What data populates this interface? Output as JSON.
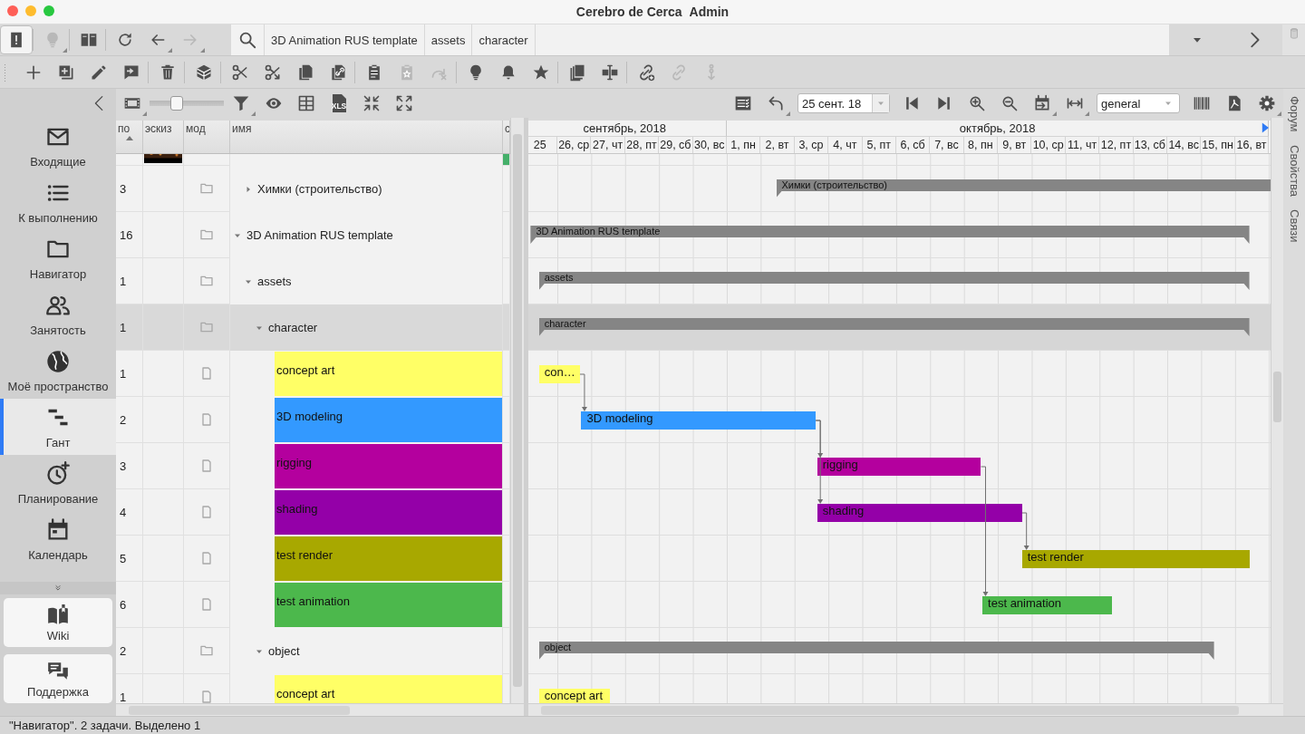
{
  "window": {
    "title": "Cerebro de Cerca",
    "user": "Admin"
  },
  "main_toolbar": {
    "buttons": [
      {
        "kind": "alert",
        "pressed": true,
        "disabled": false,
        "separator": false,
        "menu": false
      },
      {
        "kind": "lightbulb",
        "pressed": false,
        "disabled": true,
        "separator": true,
        "menu": true
      },
      {
        "kind": "book",
        "pressed": false,
        "disabled": false,
        "separator": true,
        "menu": false
      },
      {
        "kind": "refresh",
        "pressed": false,
        "disabled": false,
        "separator": true,
        "menu": false
      },
      {
        "kind": "back",
        "pressed": false,
        "disabled": false,
        "separator": false,
        "menu": true
      },
      {
        "kind": "forward",
        "pressed": false,
        "disabled": true,
        "separator": false,
        "menu": true
      }
    ],
    "breadcrumbs": [
      {
        "label": "3D Animation RUS template"
      },
      {
        "label": "assets"
      },
      {
        "label": "character"
      }
    ]
  },
  "edit_toolbar": {
    "buttons": [
      {
        "kind": "plus",
        "disabled": false,
        "separator": false
      },
      {
        "kind": "addbox",
        "disabled": false,
        "separator": false
      },
      {
        "kind": "pencil",
        "disabled": false,
        "separator": false
      },
      {
        "kind": "reply",
        "disabled": false,
        "separator": false
      },
      {
        "kind": "trash",
        "disabled": false,
        "separator": true
      },
      {
        "kind": "cube",
        "disabled": false,
        "separator": true
      },
      {
        "kind": "scissors",
        "disabled": false,
        "separator": true
      },
      {
        "kind": "scissorsarrow",
        "disabled": false,
        "separator": false
      },
      {
        "kind": "copy",
        "disabled": false,
        "separator": false
      },
      {
        "kind": "copylink",
        "disabled": false,
        "separator": false
      },
      {
        "kind": "clipboard",
        "disabled": false,
        "separator": true
      },
      {
        "kind": "clipstar",
        "disabled": true,
        "separator": false
      },
      {
        "kind": "redo",
        "disabled": true,
        "separator": false
      },
      {
        "kind": "lightbulb",
        "disabled": false,
        "separator": true
      },
      {
        "kind": "bell",
        "disabled": false,
        "separator": false
      },
      {
        "kind": "star",
        "disabled": false,
        "separator": false
      },
      {
        "kind": "stack",
        "disabled": false,
        "separator": true
      },
      {
        "kind": "textcursor",
        "disabled": false,
        "separator": false
      },
      {
        "kind": "linkplus",
        "disabled": false,
        "separator": true
      },
      {
        "kind": "link",
        "disabled": true,
        "separator": false
      },
      {
        "kind": "chaindown",
        "disabled": true,
        "separator": false
      }
    ]
  },
  "view_toolbar": {
    "items": [
      {
        "kind": "film",
        "menu": true
      },
      {
        "kind": "slider",
        "level": 0.35
      },
      {
        "kind": "filter",
        "menu": true
      },
      {
        "kind": "eye",
        "menu": false
      },
      {
        "kind": "grid",
        "menu": false
      },
      {
        "kind": "file",
        "label": "XLS",
        "menu": false
      },
      {
        "kind": "shrink",
        "menu": false
      },
      {
        "kind": "expand",
        "menu": false
      }
    ]
  },
  "gantt_toolbar": {
    "items": [
      {
        "kind": "checklist",
        "menu": false
      },
      {
        "kind": "undo",
        "menu": true
      },
      {
        "kind": "datefield",
        "value": "25 сент. 18"
      },
      {
        "kind": "skipstart",
        "menu": false
      },
      {
        "kind": "skipend",
        "menu": false
      },
      {
        "kind": "zoomin",
        "menu": false
      },
      {
        "kind": "zoomout",
        "menu": false
      },
      {
        "kind": "calendararrow",
        "menu": true
      },
      {
        "kind": "width",
        "menu": true
      },
      {
        "kind": "select",
        "value": "general"
      },
      {
        "kind": "barcode",
        "menu": false
      },
      {
        "kind": "pdf",
        "menu": false
      },
      {
        "kind": "gear",
        "menu": true
      }
    ]
  },
  "sidebar": {
    "items": [
      {
        "kind": "mail",
        "label": "Входящие",
        "selected": false
      },
      {
        "kind": "list",
        "label": "К выполнению",
        "selected": false
      },
      {
        "kind": "folder",
        "label": "Навигатор",
        "selected": false
      },
      {
        "kind": "people",
        "label": "Занятость",
        "selected": false
      },
      {
        "kind": "globe",
        "label": "Моё пространство",
        "selected": false
      },
      {
        "kind": "gantt",
        "label": "Гант",
        "selected": true
      },
      {
        "kind": "clockplus",
        "label": "Планирование",
        "selected": false
      },
      {
        "kind": "calendar",
        "label": "Календарь",
        "selected": false
      }
    ],
    "links": [
      {
        "kind": "bookopen",
        "label": "Wiki"
      },
      {
        "kind": "chat",
        "label": "Поддержка"
      }
    ]
  },
  "table": {
    "columns": [
      {
        "label": "по",
        "sorted": true
      },
      {
        "label": "эскиз",
        "sorted": false
      },
      {
        "label": "мод",
        "sorted": false
      },
      {
        "label": "имя",
        "sorted": false
      },
      {
        "label": "с",
        "sorted": false
      }
    ],
    "rows": [
      {
        "kind": "partial",
        "thumbnail": {
          "kind": "picture"
        },
        "color": "#45b06a",
        "selected": false,
        "children": [
          {
            "kind": "folder",
            "count": "3",
            "name": "Химки (строительство)",
            "expanded": false,
            "selected": false,
            "bar_label": "Химки (строительство)"
          }
        ]
      },
      {
        "kind": "folder",
        "count": "16",
        "name": "3D Animation RUS template",
        "expanded": true,
        "selected": false,
        "bar_label": "3D Animation RUS template",
        "children": [
          {
            "kind": "folder",
            "count": "1",
            "name": "assets",
            "expanded": true,
            "selected": false,
            "bar_label": "assets",
            "children": [
              {
                "kind": "folder",
                "count": "1",
                "name": "character",
                "expanded": true,
                "selected": true,
                "bar_label": "character",
                "children": [
                  {
                    "kind": "task",
                    "count": "1",
                    "name": "concept art",
                    "color": "#ffff66",
                    "selected": false,
                    "bar_label": "con…"
                  },
                  {
                    "kind": "task",
                    "count": "2",
                    "name": "3D modeling",
                    "color": "#3399ff",
                    "selected": false,
                    "bar_label": "3D modeling"
                  },
                  {
                    "kind": "task",
                    "count": "3",
                    "name": "rigging",
                    "color": "#b4009e",
                    "selected": false,
                    "bar_label": "rigging"
                  },
                  {
                    "kind": "task",
                    "count": "4",
                    "name": "shading",
                    "color": "#9400a8",
                    "selected": false,
                    "bar_label": "shading"
                  },
                  {
                    "kind": "task",
                    "count": "5",
                    "name": "test render",
                    "color": "#a8a800",
                    "selected": false,
                    "bar_label": "test render"
                  },
                  {
                    "kind": "task",
                    "count": "6",
                    "name": "test animation",
                    "color": "#4cb84c",
                    "selected": false,
                    "bar_label": "test animation"
                  }
                ]
              },
              {
                "kind": "folder",
                "count": "2",
                "name": "object",
                "expanded": true,
                "selected": false,
                "bar_label": "object",
                "children": [
                  {
                    "kind": "task",
                    "count": "1",
                    "name": "concept art",
                    "color": "#ffff66",
                    "selected": false,
                    "bar_label": "concept art"
                  }
                ]
              }
            ]
          }
        ]
      }
    ]
  },
  "gantt": {
    "months": [
      {
        "label": "сентябрь, 2018",
        "days": [
          "25",
          "26, ср",
          "27, чт",
          "28, пт",
          "29, сб",
          "30, вс"
        ]
      },
      {
        "label": "октябрь, 2018",
        "days": [
          "1, пн",
          "2, вт",
          "3, ср",
          "4, чт",
          "5, пт",
          "6, сб",
          "7, вс",
          "8, пн",
          "9, вт",
          "10, ср",
          "11, чт",
          "12, пт",
          "13, сб",
          "14, вс",
          "15, пн",
          "16, вт"
        ]
      }
    ]
  },
  "side_tabs": [
    {
      "label": "Форум"
    },
    {
      "label": "Свойства"
    },
    {
      "label": "Связи"
    }
  ],
  "status_bar": {
    "text": "\"Навигатор\". 2 задачи. Выделено 1"
  }
}
